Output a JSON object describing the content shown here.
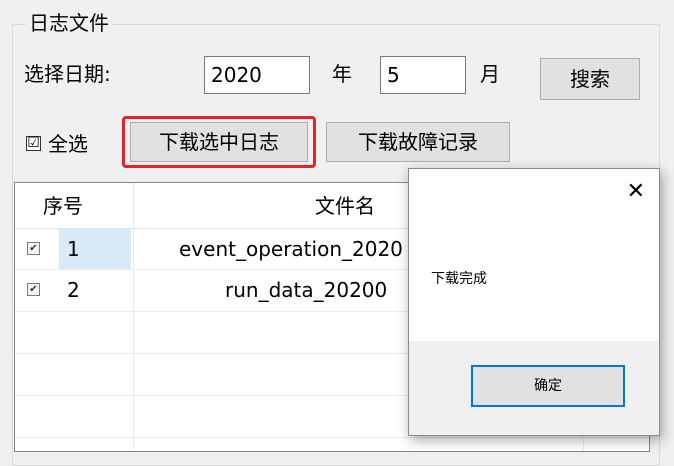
{
  "group": {
    "title": "日志文件",
    "date_label": "选择日期:",
    "year_value": "2020",
    "year_suffix": "年",
    "month_value": "5",
    "month_suffix": "月",
    "search_label": "搜索",
    "select_all_label": "全选",
    "select_all_mark": "☑",
    "download_selected_label": "下载选中日志",
    "download_fault_label": "下载故障记录"
  },
  "list": {
    "columns": [
      "序号",
      "文件名"
    ],
    "rows": [
      {
        "index": "1",
        "filename": "event_operation_2020",
        "checked": true
      },
      {
        "index": "2",
        "filename": "run_data_20200",
        "checked": true
      }
    ],
    "check_mark": "✔"
  },
  "dialog": {
    "close_glyph": "✕",
    "message": "下载完成",
    "ok_label": "确定"
  },
  "colors": {
    "focus_border": "#e0242a",
    "selection": "#d9ebf9",
    "default_button_border": "#0078d7"
  }
}
